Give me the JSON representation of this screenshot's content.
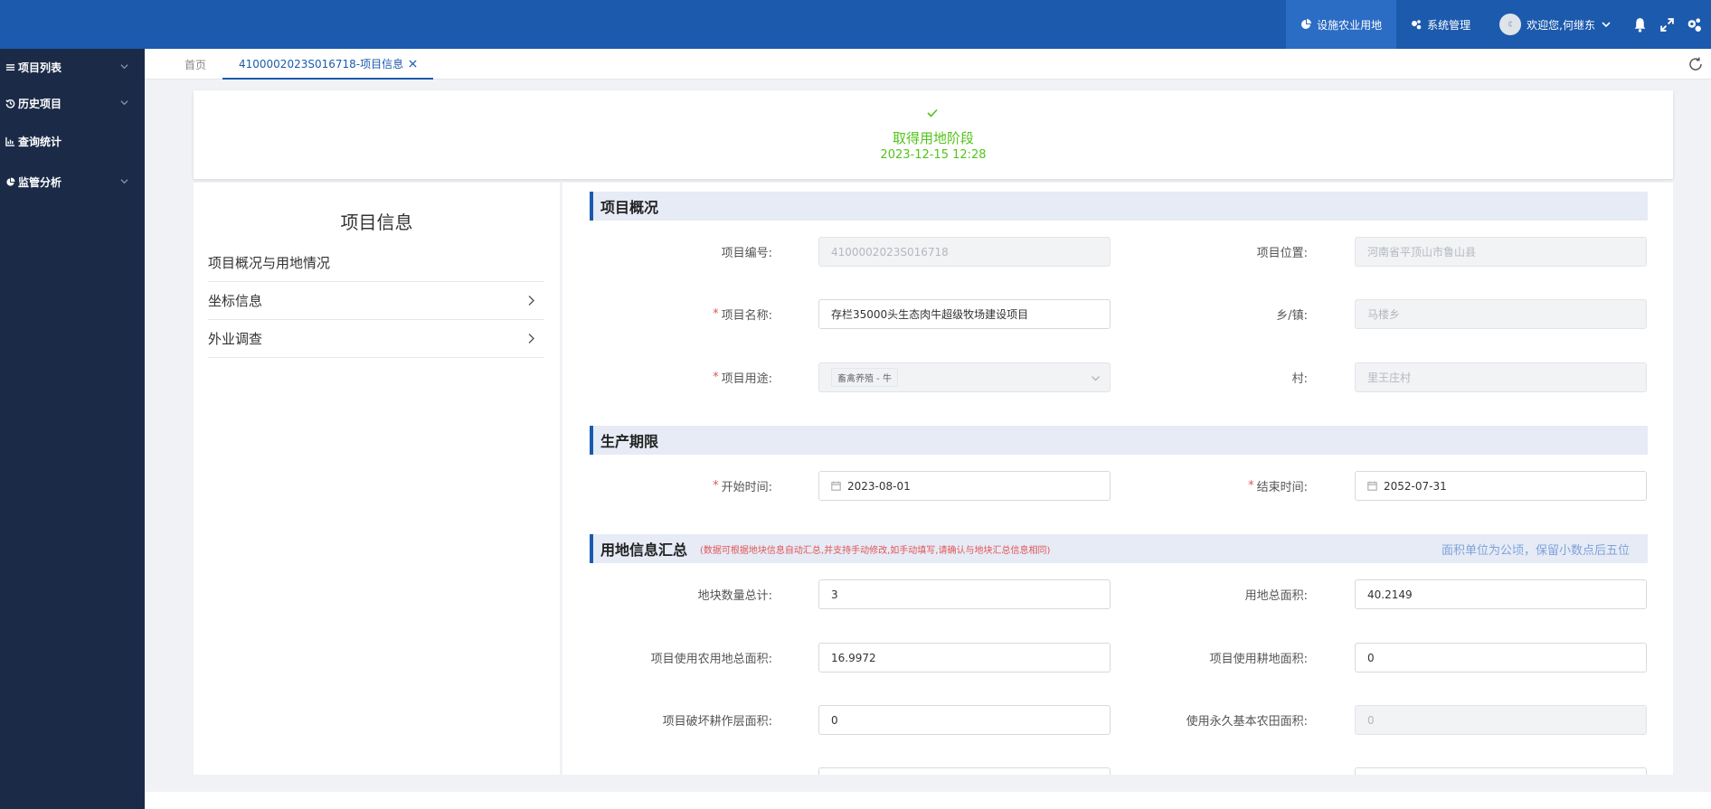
{
  "topbar": {
    "nav": [
      {
        "label": "设施农业用地",
        "active": true
      },
      {
        "label": "系统管理",
        "active": false
      }
    ],
    "avatar_text": "¢",
    "welcome": "欢迎您,何继东"
  },
  "sidebar": {
    "items": [
      {
        "label": "项目列表"
      },
      {
        "label": "历史项目"
      },
      {
        "label": "查询统计"
      },
      {
        "label": "监管分析"
      }
    ]
  },
  "tabs": {
    "home": "首页",
    "active": "4100002023S016718-项目信息"
  },
  "stage": {
    "name": "取得用地阶段",
    "time": "2023-12-15 12:28"
  },
  "left_panel": {
    "title": "项目信息",
    "items": [
      {
        "label": "项目概况与用地情况"
      },
      {
        "label": "坐标信息"
      },
      {
        "label": "外业调查"
      }
    ]
  },
  "sections": {
    "overview": {
      "title": "项目概况"
    },
    "period": {
      "title": "生产期限"
    },
    "land": {
      "title": "用地信息汇总",
      "note": "(数据可根据地块信息自动汇总,并支持手动修改,如手动填写,请确认与地块汇总信息相同)",
      "unit_hint": "面积单位为公顷，保留小数点后五位"
    }
  },
  "fields": {
    "project_no": {
      "label": "项目编号:",
      "value": "4100002023S016718"
    },
    "location": {
      "label": "项目位置:",
      "value": "河南省平顶山市鲁山县"
    },
    "project_name": {
      "label": "项目名称:",
      "value": "存栏35000头生态肉牛超级牧场建设项目"
    },
    "town": {
      "label": "乡/镇:",
      "value": "马楼乡"
    },
    "usage": {
      "label": "项目用途:",
      "value": "畜禽养殖 - 牛"
    },
    "village": {
      "label": "村:",
      "value": "里王庄村"
    },
    "start": {
      "label": "开始时间:",
      "value": "2023-08-01"
    },
    "end": {
      "label": "结束时间:",
      "value": "2052-07-31"
    },
    "plot_count": {
      "label": "地块数量总计:",
      "value": "3"
    },
    "total_area": {
      "label": "用地总面积:",
      "value": "40.2149"
    },
    "farmland_area": {
      "label": "项目使用农用地总面积:",
      "value": "16.9972"
    },
    "arable_area": {
      "label": "项目使用耕地面积:",
      "value": "0"
    },
    "damage_area": {
      "label": "项目破坏耕作层面积:",
      "value": "0"
    },
    "basic_farmland": {
      "label": "使用永久基本农田面积:",
      "value": "0"
    }
  }
}
